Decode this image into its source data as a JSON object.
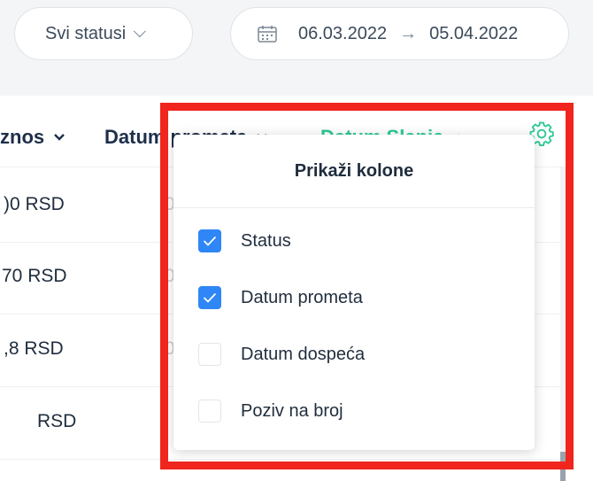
{
  "filters": {
    "status_label": "Svi statusi",
    "date_from": "06.03.2022",
    "date_arrow": "→",
    "date_to": "05.04.2022"
  },
  "table": {
    "columns": [
      {
        "label": "znos",
        "sort": "desc"
      },
      {
        "label": "Datum prometa",
        "sort": "desc"
      },
      {
        "label": "Datum Slanja",
        "sort": "asc",
        "active": true
      }
    ],
    "rows": [
      {
        "amount": ")0 RSD",
        "partial": "0"
      },
      {
        "amount": "70 RSD",
        "partial": "0"
      },
      {
        "amount": ",8 RSD",
        "partial": "0"
      },
      {
        "amount": "RSD",
        "partial": ""
      }
    ]
  },
  "column_picker": {
    "title": "Prikaži kolone",
    "options": [
      {
        "label": "Status",
        "checked": true
      },
      {
        "label": "Datum prometa",
        "checked": true
      },
      {
        "label": "Datum dospeća",
        "checked": false
      },
      {
        "label": "Poziv na broj",
        "checked": false
      }
    ]
  },
  "colors": {
    "accent_green": "#2ec995",
    "checkbox_blue": "#2f86f6",
    "highlight_red": "#f0251e",
    "header_text": "#1e2f4a"
  }
}
